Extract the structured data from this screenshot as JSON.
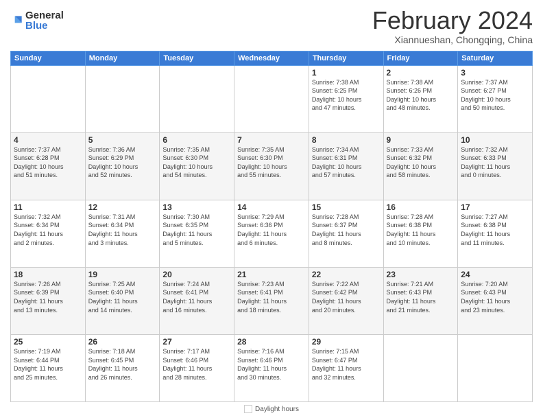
{
  "header": {
    "logo_general": "General",
    "logo_blue": "Blue",
    "title": "February 2024",
    "location": "Xiannueshan, Chongqing, China"
  },
  "days_of_week": [
    "Sunday",
    "Monday",
    "Tuesday",
    "Wednesday",
    "Thursday",
    "Friday",
    "Saturday"
  ],
  "weeks": [
    {
      "days": [
        {
          "num": "",
          "info": "",
          "empty": true
        },
        {
          "num": "",
          "info": "",
          "empty": true
        },
        {
          "num": "",
          "info": "",
          "empty": true
        },
        {
          "num": "",
          "info": "",
          "empty": true
        },
        {
          "num": "1",
          "info": "Sunrise: 7:38 AM\nSunset: 6:25 PM\nDaylight: 10 hours\nand 47 minutes.",
          "empty": false
        },
        {
          "num": "2",
          "info": "Sunrise: 7:38 AM\nSunset: 6:26 PM\nDaylight: 10 hours\nand 48 minutes.",
          "empty": false
        },
        {
          "num": "3",
          "info": "Sunrise: 7:37 AM\nSunset: 6:27 PM\nDaylight: 10 hours\nand 50 minutes.",
          "empty": false
        }
      ]
    },
    {
      "days": [
        {
          "num": "4",
          "info": "Sunrise: 7:37 AM\nSunset: 6:28 PM\nDaylight: 10 hours\nand 51 minutes.",
          "empty": false
        },
        {
          "num": "5",
          "info": "Sunrise: 7:36 AM\nSunset: 6:29 PM\nDaylight: 10 hours\nand 52 minutes.",
          "empty": false
        },
        {
          "num": "6",
          "info": "Sunrise: 7:35 AM\nSunset: 6:30 PM\nDaylight: 10 hours\nand 54 minutes.",
          "empty": false
        },
        {
          "num": "7",
          "info": "Sunrise: 7:35 AM\nSunset: 6:30 PM\nDaylight: 10 hours\nand 55 minutes.",
          "empty": false
        },
        {
          "num": "8",
          "info": "Sunrise: 7:34 AM\nSunset: 6:31 PM\nDaylight: 10 hours\nand 57 minutes.",
          "empty": false
        },
        {
          "num": "9",
          "info": "Sunrise: 7:33 AM\nSunset: 6:32 PM\nDaylight: 10 hours\nand 58 minutes.",
          "empty": false
        },
        {
          "num": "10",
          "info": "Sunrise: 7:32 AM\nSunset: 6:33 PM\nDaylight: 11 hours\nand 0 minutes.",
          "empty": false
        }
      ]
    },
    {
      "days": [
        {
          "num": "11",
          "info": "Sunrise: 7:32 AM\nSunset: 6:34 PM\nDaylight: 11 hours\nand 2 minutes.",
          "empty": false
        },
        {
          "num": "12",
          "info": "Sunrise: 7:31 AM\nSunset: 6:34 PM\nDaylight: 11 hours\nand 3 minutes.",
          "empty": false
        },
        {
          "num": "13",
          "info": "Sunrise: 7:30 AM\nSunset: 6:35 PM\nDaylight: 11 hours\nand 5 minutes.",
          "empty": false
        },
        {
          "num": "14",
          "info": "Sunrise: 7:29 AM\nSunset: 6:36 PM\nDaylight: 11 hours\nand 6 minutes.",
          "empty": false
        },
        {
          "num": "15",
          "info": "Sunrise: 7:28 AM\nSunset: 6:37 PM\nDaylight: 11 hours\nand 8 minutes.",
          "empty": false
        },
        {
          "num": "16",
          "info": "Sunrise: 7:28 AM\nSunset: 6:38 PM\nDaylight: 11 hours\nand 10 minutes.",
          "empty": false
        },
        {
          "num": "17",
          "info": "Sunrise: 7:27 AM\nSunset: 6:38 PM\nDaylight: 11 hours\nand 11 minutes.",
          "empty": false
        }
      ]
    },
    {
      "days": [
        {
          "num": "18",
          "info": "Sunrise: 7:26 AM\nSunset: 6:39 PM\nDaylight: 11 hours\nand 13 minutes.",
          "empty": false
        },
        {
          "num": "19",
          "info": "Sunrise: 7:25 AM\nSunset: 6:40 PM\nDaylight: 11 hours\nand 14 minutes.",
          "empty": false
        },
        {
          "num": "20",
          "info": "Sunrise: 7:24 AM\nSunset: 6:41 PM\nDaylight: 11 hours\nand 16 minutes.",
          "empty": false
        },
        {
          "num": "21",
          "info": "Sunrise: 7:23 AM\nSunset: 6:41 PM\nDaylight: 11 hours\nand 18 minutes.",
          "empty": false
        },
        {
          "num": "22",
          "info": "Sunrise: 7:22 AM\nSunset: 6:42 PM\nDaylight: 11 hours\nand 20 minutes.",
          "empty": false
        },
        {
          "num": "23",
          "info": "Sunrise: 7:21 AM\nSunset: 6:43 PM\nDaylight: 11 hours\nand 21 minutes.",
          "empty": false
        },
        {
          "num": "24",
          "info": "Sunrise: 7:20 AM\nSunset: 6:43 PM\nDaylight: 11 hours\nand 23 minutes.",
          "empty": false
        }
      ]
    },
    {
      "days": [
        {
          "num": "25",
          "info": "Sunrise: 7:19 AM\nSunset: 6:44 PM\nDaylight: 11 hours\nand 25 minutes.",
          "empty": false
        },
        {
          "num": "26",
          "info": "Sunrise: 7:18 AM\nSunset: 6:45 PM\nDaylight: 11 hours\nand 26 minutes.",
          "empty": false
        },
        {
          "num": "27",
          "info": "Sunrise: 7:17 AM\nSunset: 6:46 PM\nDaylight: 11 hours\nand 28 minutes.",
          "empty": false
        },
        {
          "num": "28",
          "info": "Sunrise: 7:16 AM\nSunset: 6:46 PM\nDaylight: 11 hours\nand 30 minutes.",
          "empty": false
        },
        {
          "num": "29",
          "info": "Sunrise: 7:15 AM\nSunset: 6:47 PM\nDaylight: 11 hours\nand 32 minutes.",
          "empty": false
        },
        {
          "num": "",
          "info": "",
          "empty": true
        },
        {
          "num": "",
          "info": "",
          "empty": true
        }
      ]
    }
  ],
  "footer": {
    "daylight_label": "Daylight hours"
  }
}
